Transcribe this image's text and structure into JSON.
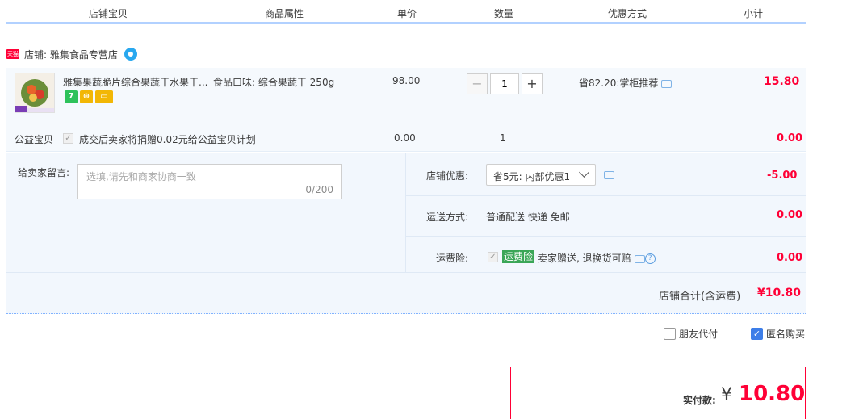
{
  "headers": [
    "店铺宝贝",
    "商品属性",
    "单价",
    "数量",
    "优惠方式",
    "小计"
  ],
  "shop": {
    "badge": "天猫",
    "name": "店铺: 雅集食品专营店"
  },
  "item": {
    "title": "雅集果蔬脆片综合果蔬干水果干...",
    "attribute": "食品口味: 综合果蔬干 250g",
    "unit_price": "98.00",
    "quantity": "1",
    "promo": "省82.20:掌柜推荐",
    "subtotal": "15.80",
    "badges": [
      "7",
      "card"
    ]
  },
  "charity": {
    "label": "公益宝贝",
    "text": "成交后卖家将捐赠0.02元给公益宝贝计划",
    "price": "0.00",
    "quantity": "1",
    "subtotal": "0.00"
  },
  "message": {
    "label": "给卖家留言:",
    "placeholder": "选填,请先和商家协商一致",
    "counter": "0/200"
  },
  "shop_discount": {
    "label": "店铺优惠:",
    "selected": "省5元: 内部优惠1",
    "value": "-5.00"
  },
  "shipping": {
    "label": "运送方式:",
    "text": "普通配送 快递 免邮",
    "value": "0.00"
  },
  "insurance": {
    "label": "运费险:",
    "badge": "运费险",
    "text": "卖家赠送, 退换货可赔",
    "value": "0.00"
  },
  "shop_total": {
    "label": "店铺合计(含运费)",
    "value": "¥10.80"
  },
  "options": {
    "friend_pay": "朋友代付",
    "anonymous": "匿名购买"
  },
  "payment": {
    "label": "实付款:",
    "currency": "¥",
    "amount": "10.80"
  },
  "colors": {
    "accent_red": "#ff0036",
    "header_line": "#b2d1ff",
    "row_bg": "#f5f9fd",
    "check_blue": "#3d7ee8"
  }
}
